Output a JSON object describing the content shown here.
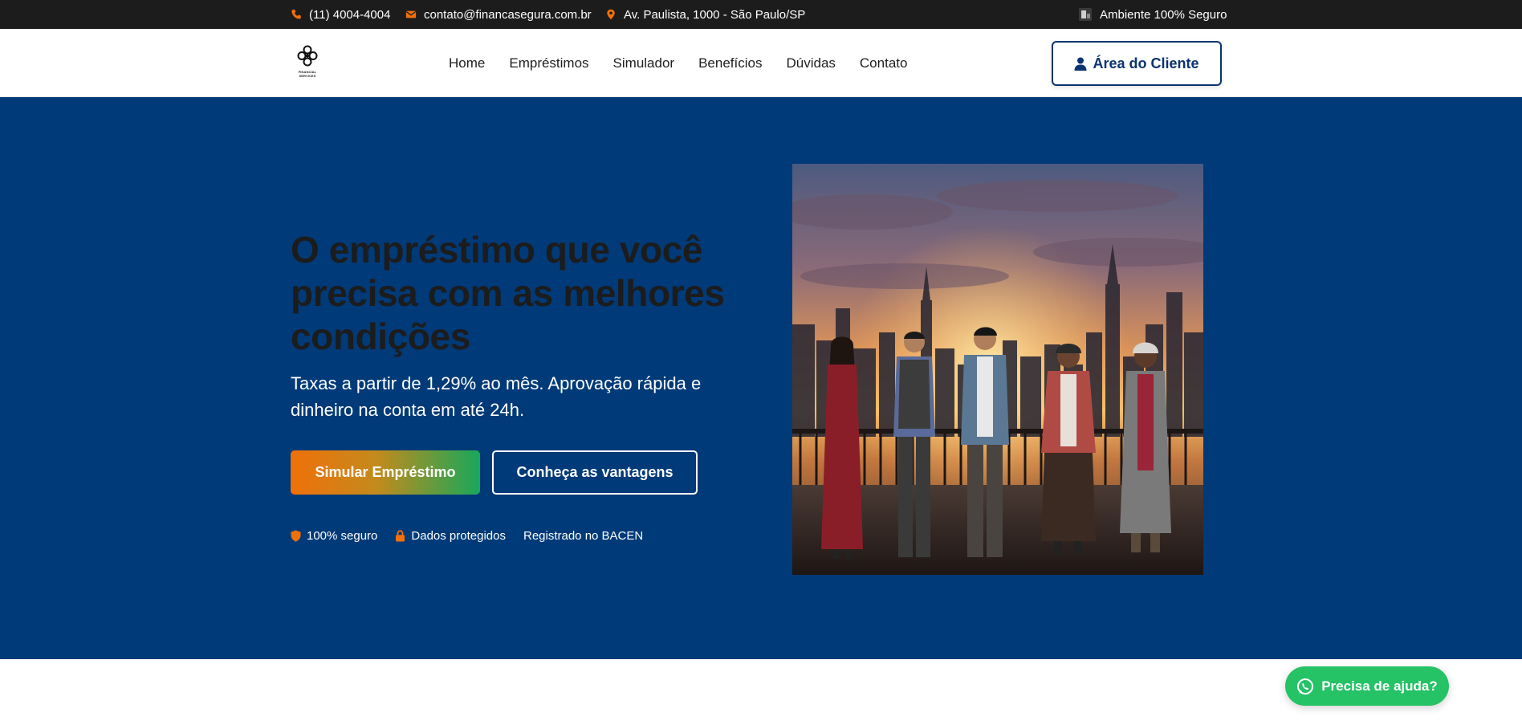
{
  "topbar": {
    "phone": "(11) 4004-4004",
    "email": "contato@financasegura.com.br",
    "address": "Av. Paulista, 1000 - São Paulo/SP",
    "secure": "Ambiente 100% Seguro"
  },
  "header": {
    "logo_caption": "FINANCIAL SERVICES",
    "nav": [
      "Home",
      "Empréstimos",
      "Simulador",
      "Benefícios",
      "Dúvidas",
      "Contato"
    ],
    "client_area": "Área do Cliente"
  },
  "hero": {
    "title": "O empréstimo que você precisa com as melhores condições",
    "subtitle": "Taxas a partir de 1,29% ao mês. Aprovação rápida e dinheiro na conta em até 24h.",
    "cta_primary": "Simular Empréstimo",
    "cta_secondary": "Conheça as vantagens",
    "badges": [
      "100% seguro",
      "Dados protegidos",
      "Registrado no BACEN"
    ]
  },
  "help_button": "Precisa de ajuda?",
  "colors": {
    "topbar_bg": "#1c1c1c",
    "accent_orange": "#f0700a",
    "hero_bg": "#003a78",
    "brand_navy": "#0a3470",
    "whatsapp_green": "#25c266"
  },
  "icons": {
    "phone": "phone-icon",
    "email": "envelope-icon",
    "address": "map-pin-icon",
    "secure": "shield-lock-icon",
    "client": "user-icon",
    "badge_secure": "shield-icon",
    "badge_protected": "lock-icon",
    "help": "whatsapp-icon"
  }
}
